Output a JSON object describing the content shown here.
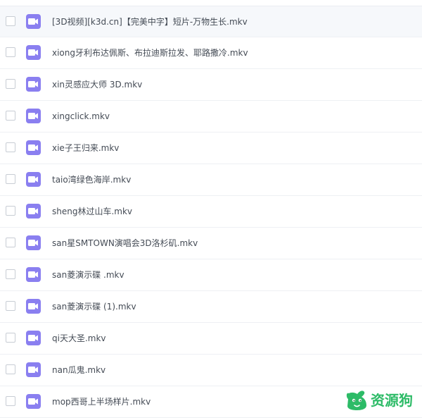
{
  "files": [
    {
      "name": "[3D视频][k3d.cn]【完美中字】短片-万物生长.mkv",
      "icon": "video-file-icon"
    },
    {
      "name": "xiong牙利布达佩斯、布拉迪斯拉发、耶路撒冷.mkv",
      "icon": "video-file-icon"
    },
    {
      "name": "xin灵感应大师 3D.mkv",
      "icon": "video-file-icon"
    },
    {
      "name": "xingclick.mkv",
      "icon": "video-file-icon"
    },
    {
      "name": "xie子王归来.mkv",
      "icon": "video-file-icon"
    },
    {
      "name": "taio湾绿色海岸.mkv",
      "icon": "video-file-icon"
    },
    {
      "name": "sheng林过山车.mkv",
      "icon": "video-file-icon"
    },
    {
      "name": "san星SMTOWN演唱会3D洛杉矶.mkv",
      "icon": "video-file-icon"
    },
    {
      "name": "san菱演示碟 .mkv",
      "icon": "video-file-icon"
    },
    {
      "name": "san菱演示碟 (1).mkv",
      "icon": "video-file-icon"
    },
    {
      "name": "qi天大圣.mkv",
      "icon": "video-file-icon"
    },
    {
      "name": "nan瓜鬼.mkv",
      "icon": "video-file-icon"
    },
    {
      "name": "mop西哥上半场样片.mkv",
      "icon": "video-file-icon"
    }
  ],
  "watermark": {
    "text": "资源狗",
    "icon": "dog-logo-icon",
    "color": "#2dbb67"
  },
  "colors": {
    "file_icon": "#8a7ff0",
    "file_text": "#444b55"
  }
}
